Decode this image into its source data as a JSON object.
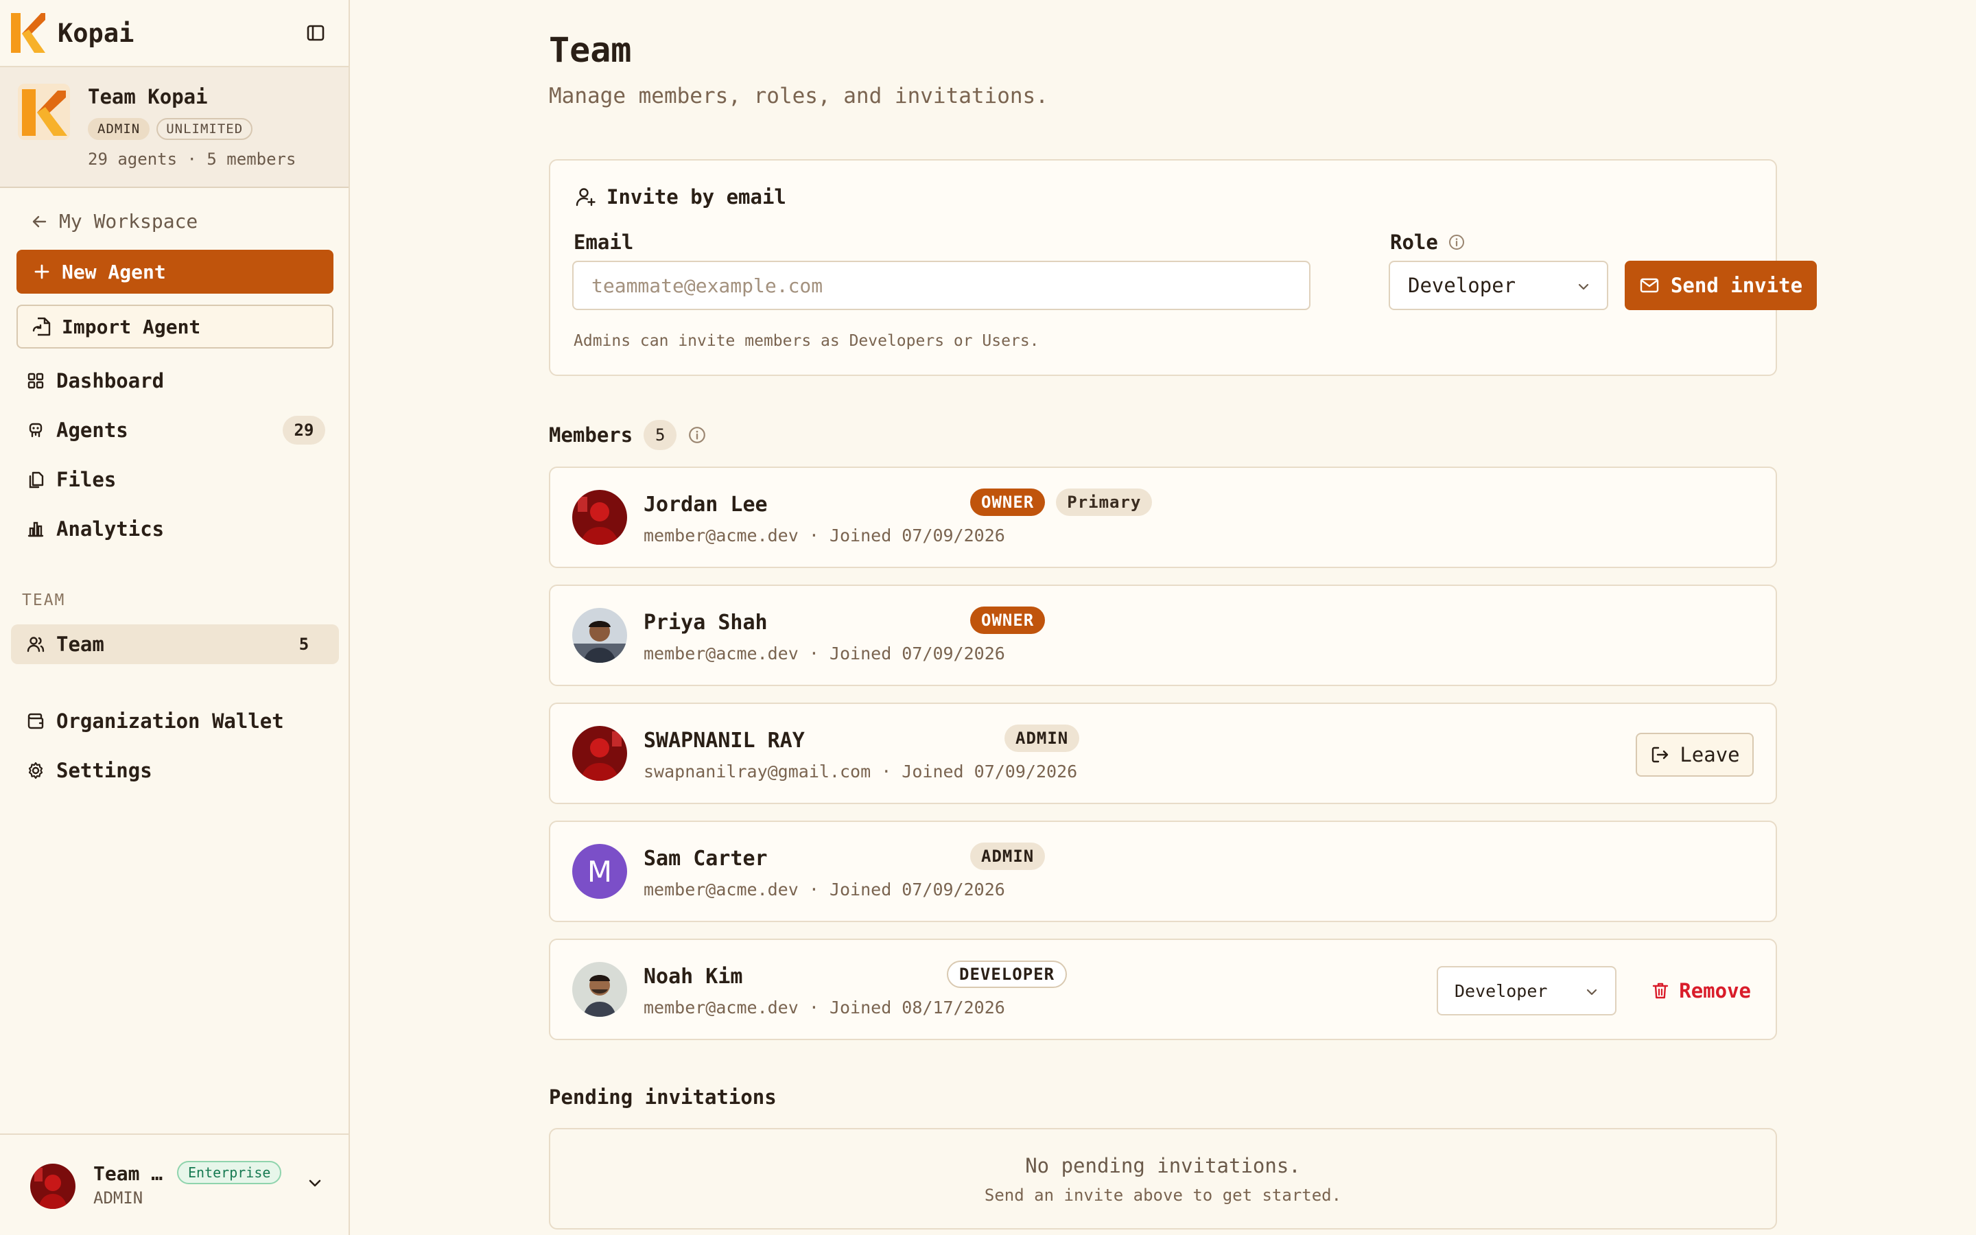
{
  "app": {
    "name": "Kopai"
  },
  "team_card": {
    "title": "Team Kopai",
    "badges": [
      "ADMIN",
      "UNLIMITED"
    ],
    "meta": "29 agents · 5 members"
  },
  "sidebar": {
    "back_label": "My Workspace",
    "new_agent": "New Agent",
    "import_agent": "Import Agent",
    "items": [
      {
        "label": "Dashboard",
        "icon": "dashboard-icon"
      },
      {
        "label": "Agents",
        "icon": "agent-icon",
        "count": "29"
      },
      {
        "label": "Files",
        "icon": "files-icon"
      },
      {
        "label": "Analytics",
        "icon": "analytics-icon"
      }
    ],
    "section_label": "TEAM",
    "team_item": {
      "label": "Team",
      "count": "5",
      "icon": "users-icon"
    },
    "lower_items": [
      {
        "label": "Organization Wallet",
        "icon": "wallet-icon"
      },
      {
        "label": "Settings",
        "icon": "settings-icon"
      }
    ],
    "footer": {
      "name": "Team …",
      "plan": "Enterprise",
      "role": "ADMIN"
    }
  },
  "page": {
    "title": "Team",
    "subtitle": "Manage members, roles, and invitations."
  },
  "invite": {
    "heading": "Invite by email",
    "email_label": "Email",
    "email_placeholder": "teammate@example.com",
    "role_label": "Role",
    "role_value": "Developer",
    "send_label": "Send invite",
    "note": "Admins can invite members as Developers or Users."
  },
  "members": {
    "heading": "Members",
    "count": "5",
    "list": [
      {
        "name": "Jordan Lee",
        "badges": [
          {
            "text": "OWNER",
            "kind": "owner"
          },
          {
            "text": "Primary",
            "kind": "primary"
          }
        ],
        "email": "member@acme.dev",
        "joined": "Joined 07/09/2026"
      },
      {
        "name": "Priya Shah",
        "badges": [
          {
            "text": "OWNER",
            "kind": "owner"
          }
        ],
        "email": "member@acme.dev",
        "joined": "Joined 07/09/2026"
      },
      {
        "name": "SWAPNANIL RAY",
        "badges": [
          {
            "text": "ADMIN",
            "kind": "admin"
          }
        ],
        "email": "swapnanilray@gmail.com",
        "joined": "Joined 07/09/2026",
        "action": "Leave"
      },
      {
        "name": "Sam Carter",
        "badges": [
          {
            "text": "ADMIN",
            "kind": "admin"
          }
        ],
        "email": "member@acme.dev",
        "joined": "Joined 07/09/2026",
        "initial": "M"
      },
      {
        "name": "Noah Kim",
        "badges": [
          {
            "text": "DEVELOPER",
            "kind": "developer"
          }
        ],
        "email": "member@acme.dev",
        "joined": "Joined 08/17/2026",
        "role_select": "Developer",
        "action": "Remove"
      }
    ]
  },
  "pending": {
    "heading": "Pending invitations",
    "empty_title": "No pending invitations.",
    "empty_sub": "Send an invite above to get started."
  },
  "colors": {
    "accent": "#c0540c",
    "danger": "#d91c2a",
    "enterprise": "#177a52"
  }
}
